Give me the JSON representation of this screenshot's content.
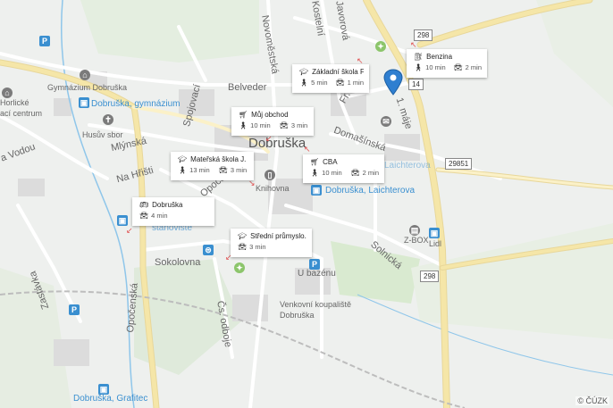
{
  "map": {
    "town": "Dobruška",
    "streets": [
      "Novoměstská",
      "Kostelní",
      "Javorová",
      "Belveder",
      "Spojovací",
      "Fr. Kupky",
      "Mlýnská",
      "Na Hřišti",
      "Domašínská",
      "1. máje",
      "Opočenská",
      "Zastávka",
      "Sokolovna",
      "Čs. odboje",
      "Solnická",
      "U bazénu",
      "Opočenská"
    ],
    "places": [
      "Gymnázium Dobruška",
      "Husův sbor",
      "Knihovna",
      "Venkovní koupaliště Dobruška",
      "Z-BOX",
      "Lidl",
      "Mateřská škola",
      "Horlické",
      "ací centrum",
      "a Vodou",
      "stanoviště"
    ],
    "stops": [
      "Dobruška, gymnázium",
      "Dobruška, Laichterova",
      "Dobruška, Grafitec",
      "Laichterova"
    ],
    "road_numbers": [
      "298",
      "14",
      "29851",
      "298"
    ],
    "copyright": "© ČÚZK"
  },
  "cards": [
    {
      "title": "Základní škola Fr...",
      "icon": "school-icon",
      "walk": "5 min",
      "drive": "1 min"
    },
    {
      "title": "Benzina",
      "icon": "gas-station-icon",
      "walk": "10 min",
      "drive": "2 min"
    },
    {
      "title": "Můj obchod",
      "icon": "cart-icon",
      "walk": "10 min",
      "drive": "3 min"
    },
    {
      "title": "Mateřská škola J. ...",
      "icon": "school-icon",
      "walk": "13 min",
      "drive": "3 min"
    },
    {
      "title": "CBA",
      "icon": "cart-icon",
      "walk": "10 min",
      "drive": "2 min"
    },
    {
      "title": "Dobruška",
      "icon": "bus-icon",
      "drive": "4 min"
    },
    {
      "title": "Střední průmyslo...",
      "icon": "school-icon",
      "drive": "3 min"
    }
  ],
  "colors": {
    "road_major": "#f5e6a8",
    "road_minor": "#ffffff",
    "water": "#8fc6ea",
    "green": "#d7e8c8",
    "pin": "#2f7fd0"
  }
}
